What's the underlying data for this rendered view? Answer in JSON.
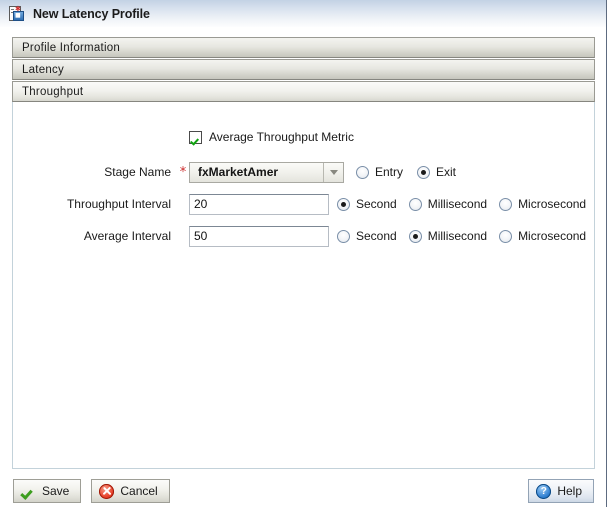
{
  "window": {
    "title": "New Latency Profile",
    "title_icon": "profile-document-icon"
  },
  "accordion": {
    "sections": [
      {
        "label": "Profile Information",
        "state": "collapsed"
      },
      {
        "label": "Latency",
        "state": "collapsed"
      },
      {
        "label": "Throughput",
        "state": "expanded"
      }
    ]
  },
  "form": {
    "average_throughput_metric": {
      "label": "Average Throughput Metric",
      "checked": true
    },
    "stage_name": {
      "label": "Stage Name",
      "required_marker": "*",
      "value": "fxMarketAmer",
      "options": [
        "fxMarketAmer"
      ],
      "direction": {
        "options": [
          "Entry",
          "Exit"
        ],
        "selected": "Exit"
      }
    },
    "throughput_interval": {
      "label": "Throughput Interval",
      "value": "20",
      "units": {
        "options": [
          "Second",
          "Millisecond",
          "Microsecond"
        ],
        "selected": "Second"
      }
    },
    "average_interval": {
      "label": "Average Interval",
      "value": "50",
      "units": {
        "options": [
          "Second",
          "Millisecond",
          "Microsecond"
        ],
        "selected": "Millisecond"
      }
    }
  },
  "footer": {
    "save_label": "Save",
    "save_icon": "green-check-icon",
    "cancel_label": "Cancel",
    "cancel_icon": "red-x-circle-icon",
    "help_label": "Help",
    "help_icon": "blue-question-icon"
  },
  "colors": {
    "required_asterisk": "#cc2b2b",
    "checkbox_check": "#10a410",
    "titlebar_top": "#c3d2e4",
    "accent_blue": "#2f7fd1"
  }
}
